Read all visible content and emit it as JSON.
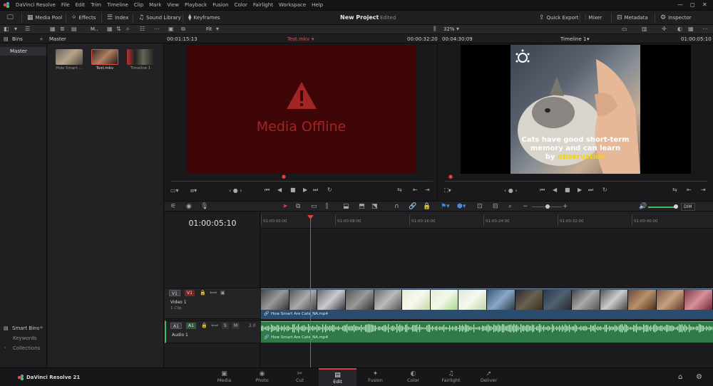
{
  "app": {
    "title": "DaVinci Resolve",
    "menu": [
      "File",
      "Edit",
      "Trim",
      "Timeline",
      "Clip",
      "Mark",
      "View",
      "Playback",
      "Fusion",
      "Color",
      "Fairlight",
      "Workspace",
      "Help"
    ],
    "window_controls": [
      "—",
      "◻",
      "✕"
    ]
  },
  "toolbar": {
    "media_pool": "Media Pool",
    "effects": "Effects",
    "index": "Index",
    "sound_library": "Sound Library",
    "keyframes": "Keyframes",
    "project_title": "New Project",
    "project_status": "Edited",
    "quick_export": "Quick Export",
    "mixer": "Mixer",
    "metadata": "Metadata",
    "inspector": "Inspector"
  },
  "subbar": {
    "view_mode": "M..",
    "fit": "Fit",
    "zoom": "32%"
  },
  "infobar": {
    "source_duration": "00:01:15:13",
    "source_clip": "Test.mkv",
    "source_timecode": "00:00:32:20",
    "program_duration": "00:04:30:09",
    "timeline_name": "Timeline 1",
    "program_timecode": "01:00:05:10"
  },
  "bins": {
    "header": "Bins",
    "master": "Master",
    "smart_bins": "Smart Bins",
    "keywords": "Keywords",
    "collections": "Collections"
  },
  "media_pool": {
    "header": "Master",
    "items": [
      {
        "label": "How Smart ..."
      },
      {
        "label": "Test.mkv"
      },
      {
        "label": "Timeline 1"
      }
    ]
  },
  "source_viewer": {
    "offline_text": "Media Offline"
  },
  "program_viewer": {
    "caption_line1": "Cats have good short-term",
    "caption_line2": "memory and can learn",
    "caption_line3a": "by ",
    "caption_line3b": "observation"
  },
  "timeline": {
    "timecode": "01:00:05:10",
    "ruler": [
      "01:00:00:00",
      "01:00:08:00",
      "01:00:16:00",
      "01:00:24:00",
      "01:00:32:00",
      "01:00:40:00"
    ],
    "video_track": {
      "badge1": "V1",
      "badge2": "V1",
      "name": "Video 1",
      "sub": "1 Clip"
    },
    "audio_track": {
      "badge1": "A1",
      "badge2": "A1",
      "s": "S",
      "m": "M",
      "level": "2.0",
      "name": "Audio 1"
    },
    "video_clip_name": "How Smart Are Cats_NA.mp4",
    "audio_clip_name": "How Smart Are Cats_NA.mp4",
    "dim": "DIM"
  },
  "footer": {
    "brand": "DaVinci Resolve 21",
    "pages": [
      {
        "label": "Media",
        "icon": "▣"
      },
      {
        "label": "Photo",
        "icon": "◉"
      },
      {
        "label": "Cut",
        "icon": "✂"
      },
      {
        "label": "Edit",
        "icon": "▤"
      },
      {
        "label": "Fusion",
        "icon": "✦"
      },
      {
        "label": "Color",
        "icon": "◐"
      },
      {
        "label": "Fairlight",
        "icon": "♫"
      },
      {
        "label": "Deliver",
        "icon": "➚"
      }
    ],
    "active_page": "Edit"
  },
  "colors": {
    "accent": "#e04040",
    "offline_bg": "#3f0607",
    "video_clip": "#2a4c6e",
    "audio_clip": "#2f7a47"
  }
}
